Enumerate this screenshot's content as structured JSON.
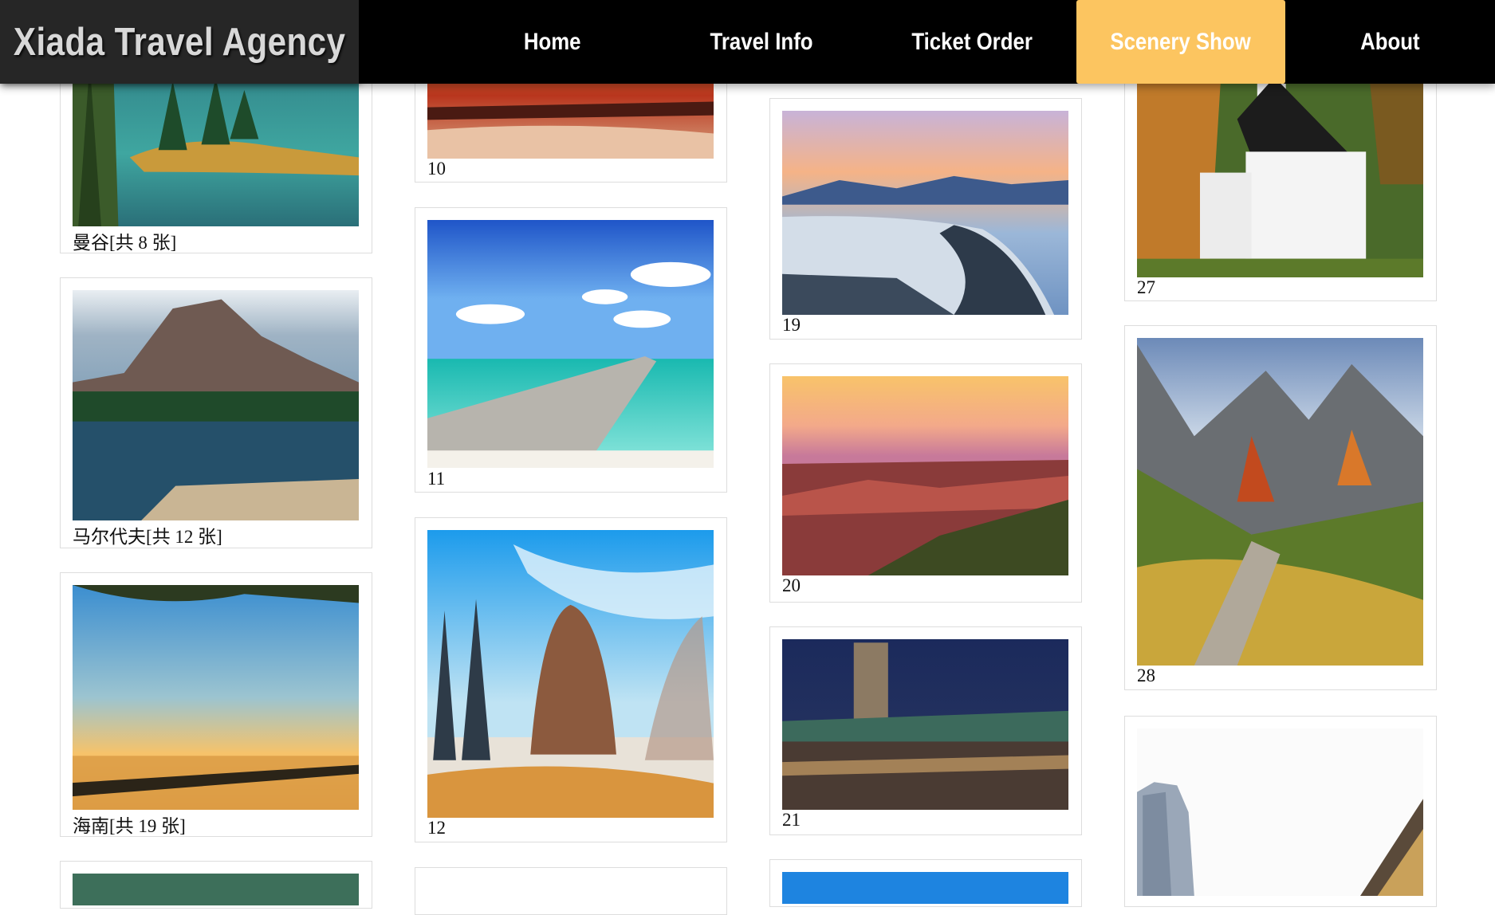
{
  "header": {
    "logo": "Xiada Travel Agency",
    "menu": [
      "Home",
      "Travel Info",
      "Ticket Order",
      "Scenery Show",
      "About"
    ],
    "active": "Scenery Show",
    "active_color": "#fcc560"
  },
  "gallery": {
    "captions": {
      "c1": "曼谷[共 8 张]",
      "c2": "马尔代夫[共 12 张]",
      "c3": "海南[共 19 张]",
      "c10": "10",
      "c11": "11",
      "c12": "12",
      "c19": "19",
      "c20": "20",
      "c21": "21",
      "c27": "27",
      "c28": "28"
    },
    "photos": [
      "forest-lake-photo",
      "mountain-lake-dock-photo",
      "sunset-pier-photo",
      "tropical-beach-sunset-photo",
      "ocean-pier-photo",
      "winter-trees-photo",
      "coastal-city-dusk-photo",
      "canyon-sunset-photo",
      "city-hall-night-photo",
      "white-church-photo",
      "alpine-autumn-photo",
      "paris-building-photo"
    ]
  }
}
